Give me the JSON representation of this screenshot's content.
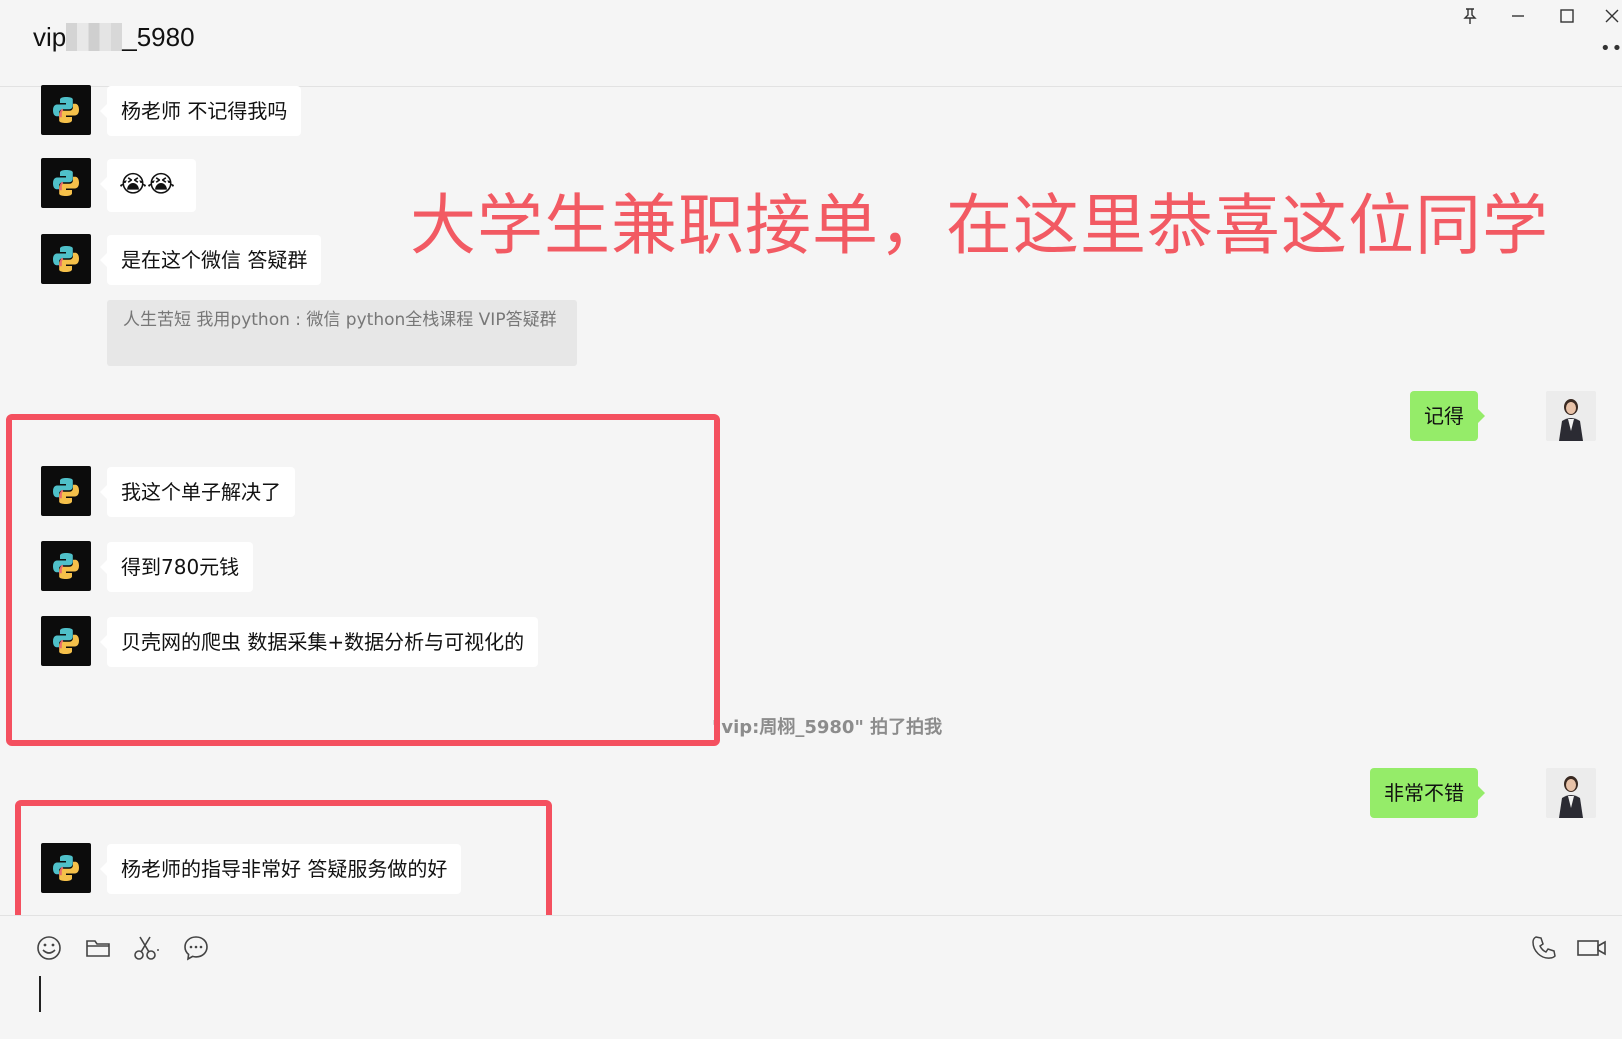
{
  "window": {
    "title_prefix": "vip",
    "title_suffix": "_5980"
  },
  "messages": {
    "m1": "杨老师 不记得我吗",
    "m2": "😭😭",
    "m3": "是在这个微信 答疑群",
    "quote": "人生苦短 我用python : 微信 python全栈课程 VIP答疑群",
    "reply1": "记得",
    "m4": "我这个单子解决了",
    "m5": "得到780元钱",
    "m6": "贝壳网的爬虫 数据采集+数据分析与可视化的",
    "system_note": "\"vip:周栩_5980\" 拍了拍我",
    "reply2": "非常不错",
    "m7": "杨老师的指导非常好 答疑服务做的好"
  },
  "overlay": {
    "headline": "大学生兼职接单，在这里恭喜这位同学"
  },
  "icons": {
    "titlebar": [
      "pin-icon",
      "minimize-icon",
      "maximize-icon",
      "close-icon",
      "more-icon"
    ],
    "toolbar": [
      "emoji-icon",
      "folder-icon",
      "scissors-icon",
      "chat-history-icon",
      "phone-icon",
      "video-call-icon"
    ]
  },
  "colors": {
    "outgoing_bubble": "#95ec69",
    "incoming_bubble": "#ffffff",
    "highlight": "#f4505f",
    "headline": "#f25a63"
  }
}
